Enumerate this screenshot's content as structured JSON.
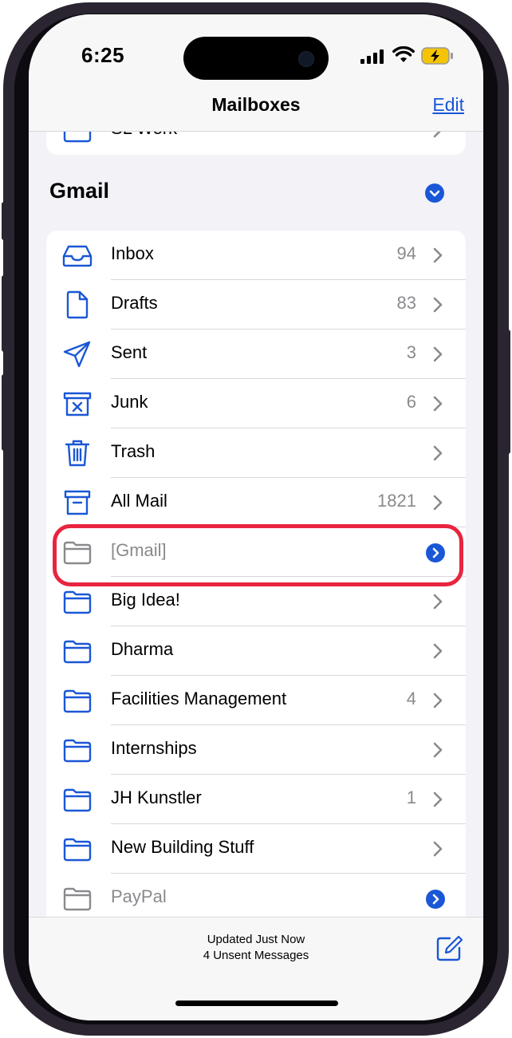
{
  "status": {
    "time": "6:25"
  },
  "nav": {
    "title": "Mailboxes",
    "edit_label": "Edit"
  },
  "prev_section": {
    "item_label": "SL Work"
  },
  "gmail": {
    "title": "Gmail",
    "items": [
      {
        "label": "Inbox",
        "count": "94",
        "icon": "inbox-icon"
      },
      {
        "label": "Drafts",
        "count": "83",
        "icon": "drafts-icon"
      },
      {
        "label": "Sent",
        "count": "3",
        "icon": "sent-icon"
      },
      {
        "label": "Junk",
        "count": "6",
        "icon": "junk-icon"
      },
      {
        "label": "Trash",
        "count": "",
        "icon": "trash-icon"
      },
      {
        "label": "All Mail",
        "count": "1821",
        "icon": "archive-icon"
      },
      {
        "label": "[Gmail]",
        "count": "",
        "icon": "folder-icon"
      },
      {
        "label": "Big Idea!",
        "count": "",
        "icon": "folder-icon"
      },
      {
        "label": "Dharma",
        "count": "",
        "icon": "folder-icon"
      },
      {
        "label": "Facilities Management",
        "count": "4",
        "icon": "folder-icon"
      },
      {
        "label": "Internships",
        "count": "",
        "icon": "folder-icon"
      },
      {
        "label": "JH Kunstler",
        "count": "1",
        "icon": "folder-icon"
      },
      {
        "label": "New Building Stuff",
        "count": "",
        "icon": "folder-icon"
      },
      {
        "label": "PayPal",
        "count": "",
        "icon": "folder-icon"
      }
    ]
  },
  "toolbar": {
    "line1": "Updated Just Now",
    "line2": "4 Unsent Messages"
  },
  "colors": {
    "accent": "#1a57d6",
    "highlight": "#e8243f"
  }
}
